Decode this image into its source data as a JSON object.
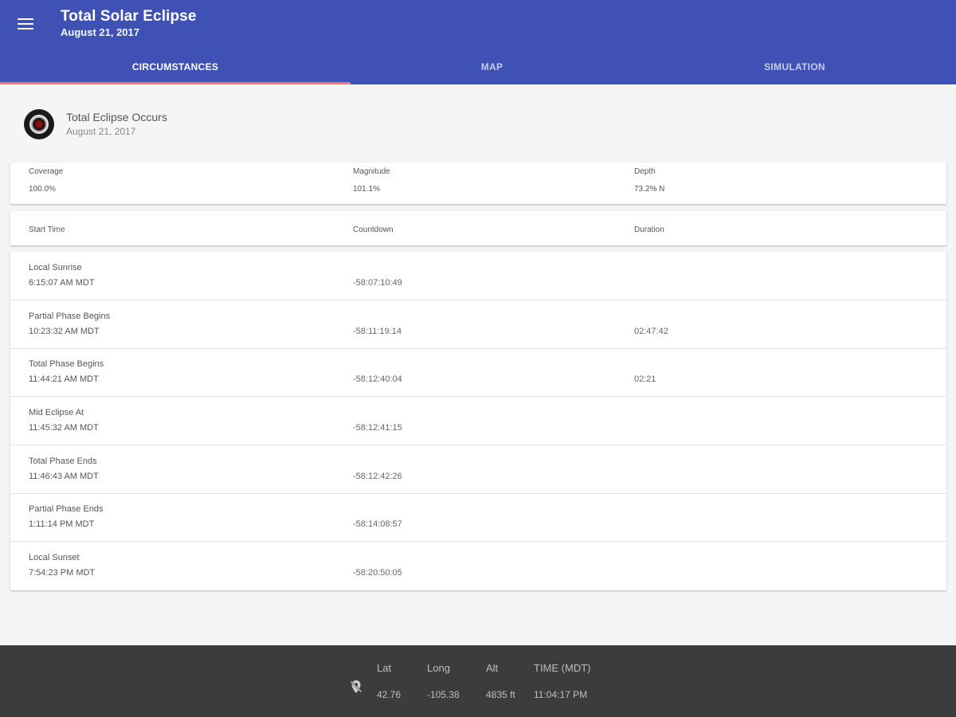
{
  "appbar": {
    "title": "Total Solar Eclipse",
    "subtitle": "August 21, 2017",
    "menu_icon": "menu-icon"
  },
  "tabs": [
    {
      "label": "CIRCUMSTANCES",
      "active": true
    },
    {
      "label": "MAP",
      "active": false
    },
    {
      "label": "SIMULATION",
      "active": false
    }
  ],
  "event": {
    "title": "Total Eclipse Occurs",
    "date": "August 21, 2017",
    "icon": "eclipse-icon"
  },
  "stats": {
    "coverage_label": "Coverage",
    "coverage_value": "100.0%",
    "magnitude_label": "Magnitude",
    "magnitude_value": "101.1%",
    "depth_label": "Depth",
    "depth_value": "73.2% N"
  },
  "table_header": {
    "start_time": "Start Time",
    "countdown": "Countdown",
    "duration": "Duration"
  },
  "rows": [
    {
      "name": "Local Sunrise",
      "time": "6:15:07 AM MDT",
      "countdown": "-58:07:10:49",
      "duration": ""
    },
    {
      "name": "Partial Phase Begins",
      "time": "10:23:32 AM MDT",
      "countdown": "-58:11:19:14",
      "duration": "02:47:42"
    },
    {
      "name": "Total Phase Begins",
      "time": "11:44:21 AM MDT",
      "countdown": "-58:12:40:04",
      "duration": "02:21"
    },
    {
      "name": "Mid Eclipse At",
      "time": "11:45:32 AM MDT",
      "countdown": "-58:12:41:15",
      "duration": ""
    },
    {
      "name": "Total Phase Ends",
      "time": "11:46:43 AM MDT",
      "countdown": "-58:12:42:26",
      "duration": ""
    },
    {
      "name": "Partial Phase Ends",
      "time": "1:11:14 PM MDT",
      "countdown": "-58:14:08:57",
      "duration": ""
    },
    {
      "name": "Local Sunset",
      "time": "7:54:23 PM MDT",
      "countdown": "-58:20:50:05",
      "duration": ""
    }
  ],
  "location": {
    "icon": "location-off-icon",
    "lat_label": "Lat",
    "lat_value": "42.76",
    "long_label": "Long",
    "long_value": "-105.38",
    "alt_label": "Alt",
    "alt_value": "4835 ft",
    "time_label": "TIME (MDT)",
    "time_value": "11:04:17 PM"
  }
}
